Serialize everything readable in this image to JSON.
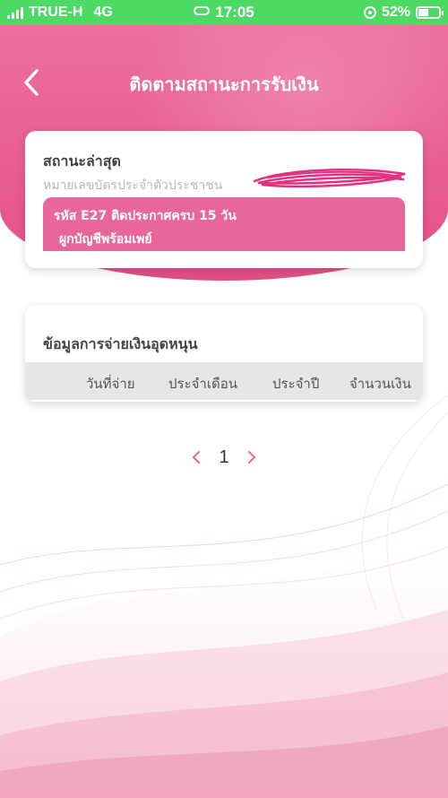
{
  "status_bar": {
    "carrier": "TRUE-H",
    "network": "4G",
    "time": "17:05",
    "battery_percent": "52%",
    "battery_level": 0.52
  },
  "header": {
    "title": "ติดตามสถานะการรับเงิน",
    "back_icon": "chevron-left-icon"
  },
  "status_card": {
    "title": "สถานะล่าสุด",
    "id_label": "หมายเลขบัตรประจำตัวประชาชน",
    "status_line1": "รหัส E27  ติดประกาศครบ 15 วัน",
    "status_line2": "ผูกบัญชีพร้อมเพย์"
  },
  "payment_card": {
    "title": "ข้อมูลการจ่ายเงินอุดหนุน",
    "columns": [
      "วันที่จ่าย",
      "ประจำเดือน",
      "ประจำปี",
      "จำนวนเงิน"
    ]
  },
  "pagination": {
    "current_page": "1"
  },
  "colors": {
    "status_bar": "#4cd964",
    "primary_pink": "#e8679a",
    "header_pink": "#ec6f9e",
    "redaction": "#e5307f"
  }
}
